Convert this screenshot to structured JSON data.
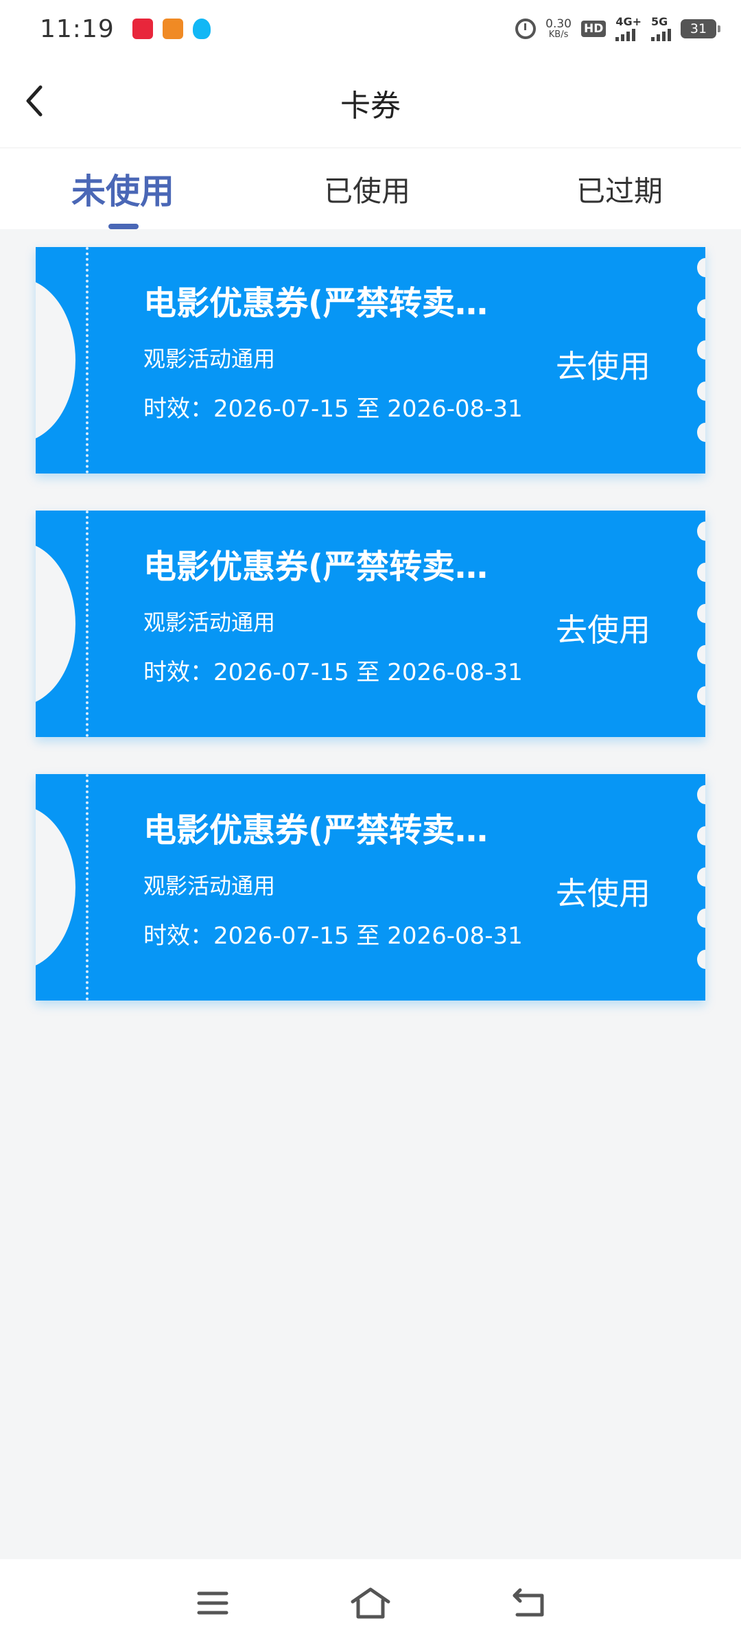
{
  "status_bar": {
    "time": "11:19",
    "net_speed_value": "0.30",
    "net_speed_unit": "KB/s",
    "hd_label": "HD",
    "network_4g": "4G+",
    "network_5g": "5G",
    "battery": "31"
  },
  "header": {
    "title": "卡券"
  },
  "tabs": [
    {
      "label": "未使用",
      "active": true
    },
    {
      "label": "已使用",
      "active": false
    },
    {
      "label": "已过期",
      "active": false
    }
  ],
  "coupons": [
    {
      "title": "电影优惠券(严禁转卖…",
      "subtitle": "观影活动通用",
      "validity": "时效：2026-07-15 至 2026-08-31",
      "action": "去使用"
    },
    {
      "title": "电影优惠券(严禁转卖…",
      "subtitle": "观影活动通用",
      "validity": "时效：2026-07-15 至 2026-08-31",
      "action": "去使用"
    },
    {
      "title": "电影优惠券(严禁转卖…",
      "subtitle": "观影活动通用",
      "validity": "时效：2026-07-15 至 2026-08-31",
      "action": "去使用"
    }
  ],
  "icons": {
    "back": "chevron-left-icon",
    "nav_menu": "menu-icon",
    "nav_home": "home-icon",
    "nav_back": "back-arrow-icon"
  },
  "colors": {
    "accent": "#4a67b6",
    "coupon_bg": "#0796f5",
    "page_bg": "#f4f5f6"
  }
}
